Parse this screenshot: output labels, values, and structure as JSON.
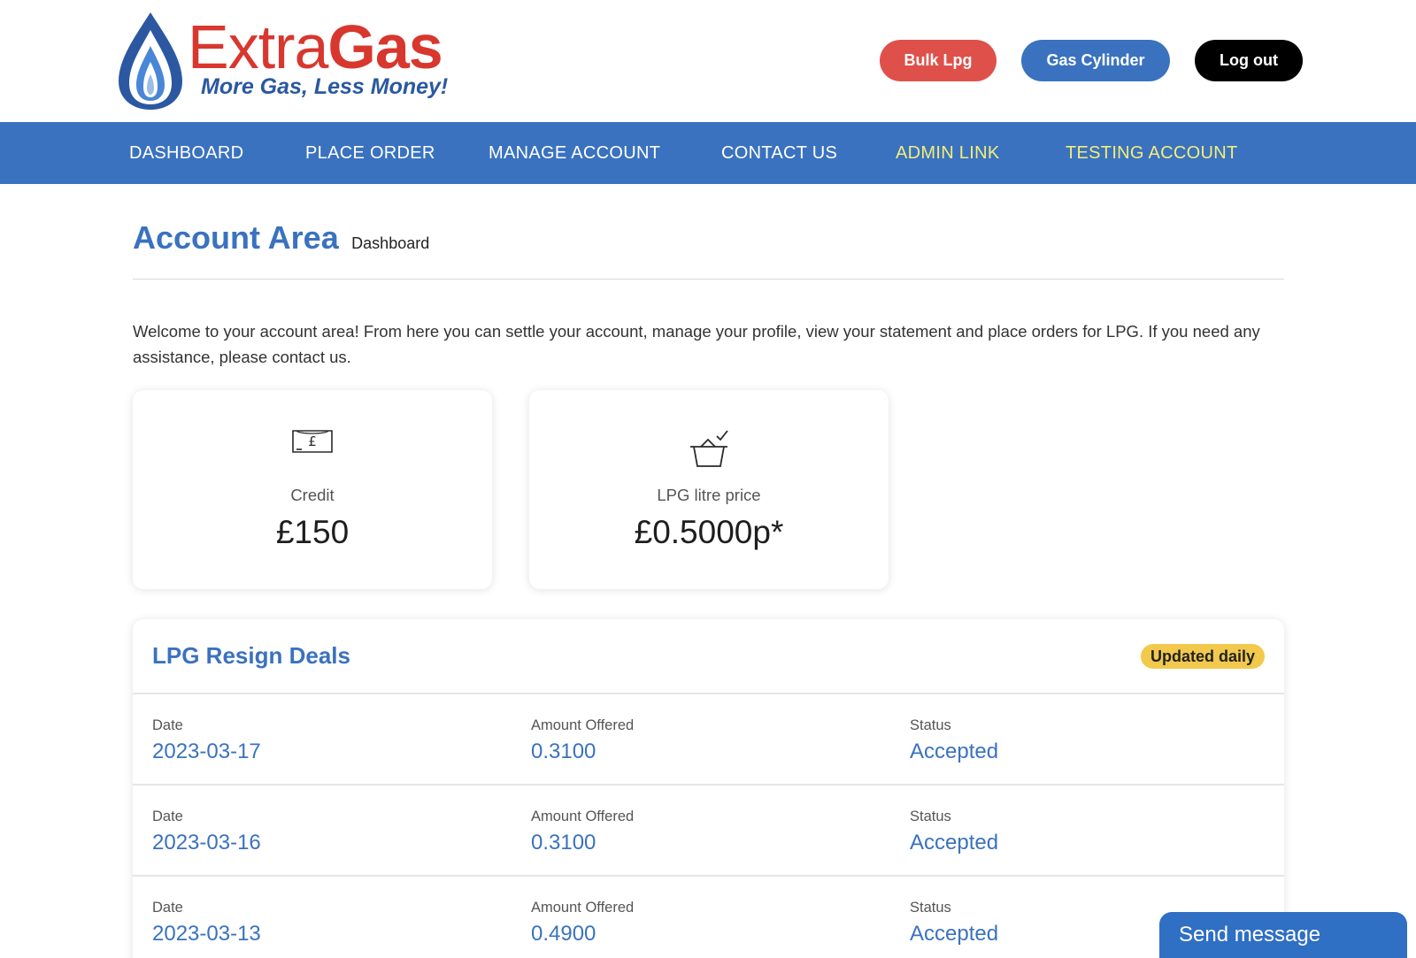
{
  "brand": {
    "name_part1": "Extra",
    "name_part2": "Gas",
    "tagline": "More Gas, Less Money!"
  },
  "header_buttons": {
    "bulk": "Bulk Lpg",
    "cylinder": "Gas Cylinder",
    "logout": "Log out"
  },
  "nav": {
    "items": [
      {
        "label": "DASHBOARD"
      },
      {
        "label": "PLACE ORDER"
      },
      {
        "label": "MANAGE ACCOUNT"
      },
      {
        "label": "CONTACT US"
      },
      {
        "label": "ADMIN LINK"
      },
      {
        "label": "TESTING ACCOUNT"
      }
    ]
  },
  "page": {
    "title": "Account Area",
    "subtitle": "Dashboard",
    "welcome": "Welcome to your account area! From here you can settle your account, manage your profile, view your statement and place orders for LPG. If you need any assistance, please contact us."
  },
  "cards": {
    "credit": {
      "label": "Credit",
      "value": "£150",
      "icon": "banknote-icon"
    },
    "lpg_price": {
      "label": "LPG litre price",
      "value": "£0.5000p*",
      "icon": "basket-check-icon"
    }
  },
  "deals": {
    "title": "LPG Resign Deals",
    "badge": "Updated daily",
    "columns": {
      "date": "Date",
      "amount": "Amount Offered",
      "status": "Status"
    },
    "rows": [
      {
        "date": "2023-03-17",
        "amount": "0.3100",
        "status": "Accepted"
      },
      {
        "date": "2023-03-16",
        "amount": "0.3100",
        "status": "Accepted"
      },
      {
        "date": "2023-03-13",
        "amount": "0.4900",
        "status": "Accepted"
      }
    ]
  },
  "chat": {
    "label": "Send message"
  },
  "colors": {
    "brand_blue": "#3a72bf",
    "brand_red": "#e0504a",
    "nav_highlight": "#f2ee7b",
    "logout_black": "#000000",
    "badge_yellow": "#f2c94c",
    "chat_blue": "#2f6fc4"
  }
}
